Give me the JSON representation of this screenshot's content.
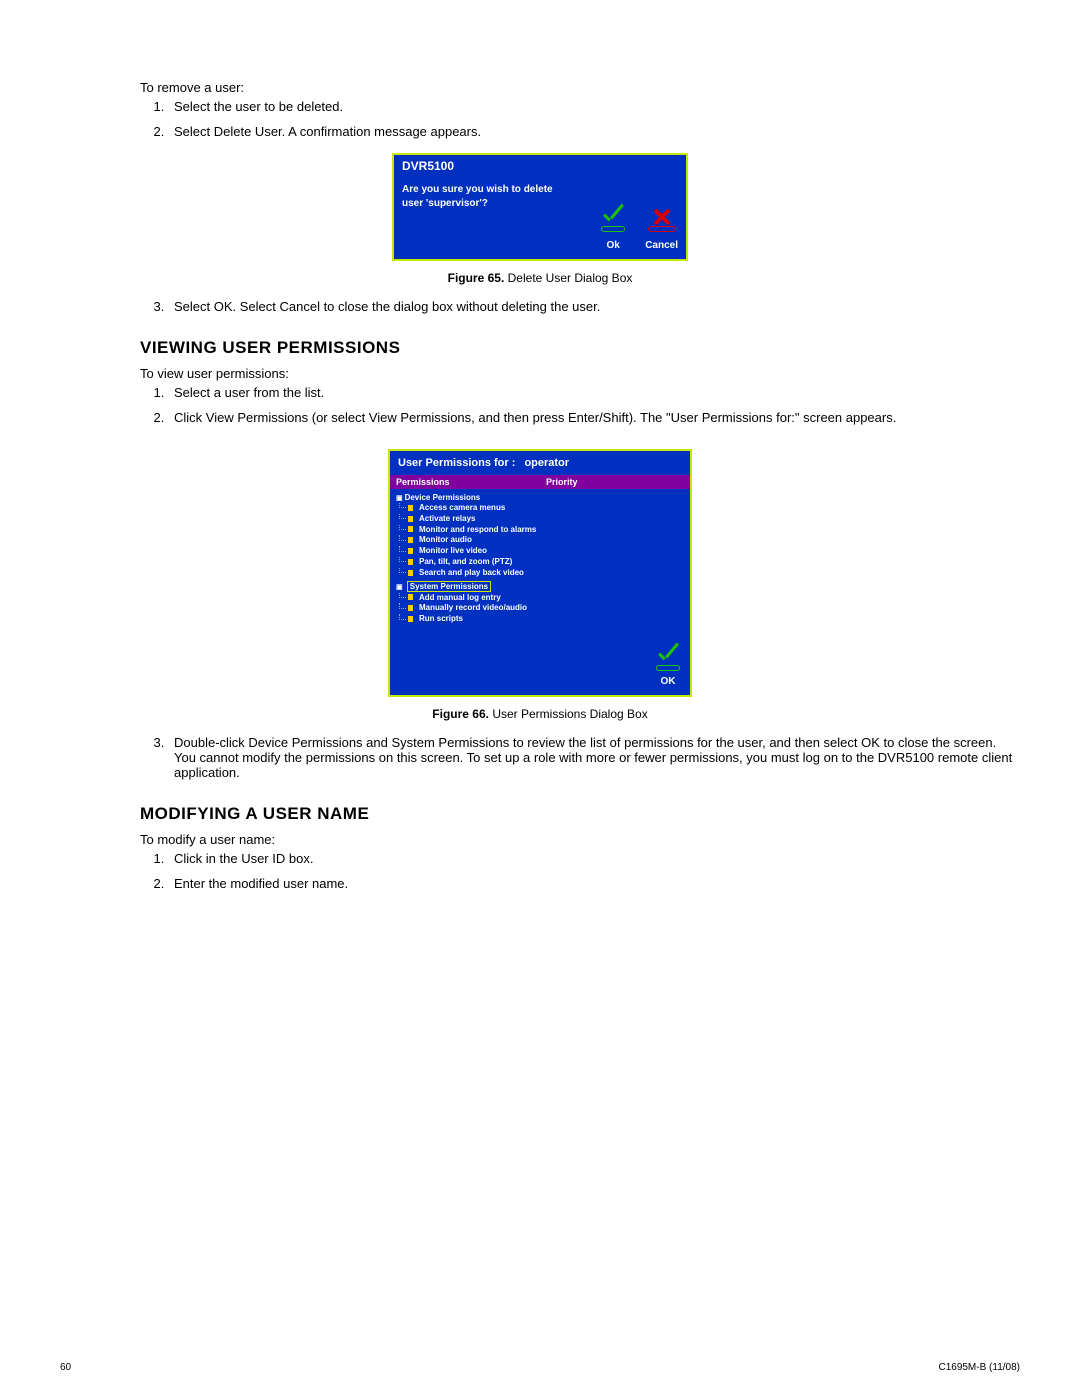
{
  "sections": {
    "removeUser": {
      "intro": "To remove a user:",
      "step1": "Select the user to be deleted.",
      "step2": "Select Delete User. A confirmation message appears.",
      "step3": "Select OK. Select Cancel to close the dialog box without deleting the user."
    },
    "viewPerms": {
      "heading": "VIEWING USER PERMISSIONS",
      "intro": "To view user permissions:",
      "step1": "Select a user from the list.",
      "step2": "Click View Permissions (or select View Permissions, and then press Enter/Shift). The \"User Permissions for:\" screen appears.",
      "step3": "Double-click Device Permissions and System Permissions to review the list of permissions for the user, and then select OK to close the screen. You cannot modify the permissions on this screen. To set up a role with more or fewer permissions, you must log on to the DVR5100 remote client application."
    },
    "modifyName": {
      "heading": "MODIFYING A USER NAME",
      "intro": "To modify a user name:",
      "step1": "Click in the User ID box.",
      "step2": "Enter the modified user name."
    }
  },
  "fig65": {
    "caption_label": "Figure 65.",
    "caption_text": "Delete User Dialog Box",
    "title": "DVR5100",
    "msg_line1": "Are you sure you wish to delete",
    "msg_line2": "user 'supervisor'?",
    "ok": "Ok",
    "cancel": "Cancel"
  },
  "fig66": {
    "caption_label": "Figure 66.",
    "caption_text": "User Permissions Dialog Box",
    "title_prefix": "User Permissions for :",
    "title_user": "operator",
    "col_permissions": "Permissions",
    "col_priority": "Priority",
    "device_root": "Device Permissions",
    "device_items": {
      "i0": "Access camera menus",
      "i1": "Activate relays",
      "i2": "Monitor and respond to alarms",
      "i3": "Monitor audio",
      "i4": "Monitor live video",
      "i5": "Pan, tilt, and zoom (PTZ)",
      "i6": "Search and play back video"
    },
    "system_root": "System Permissions",
    "system_items": {
      "i0": "Add manual log entry",
      "i1": "Manually record video/audio",
      "i2": "Run scripts"
    },
    "ok": "OK"
  },
  "footer": {
    "page": "60",
    "docid": "C1695M-B (11/08)"
  }
}
